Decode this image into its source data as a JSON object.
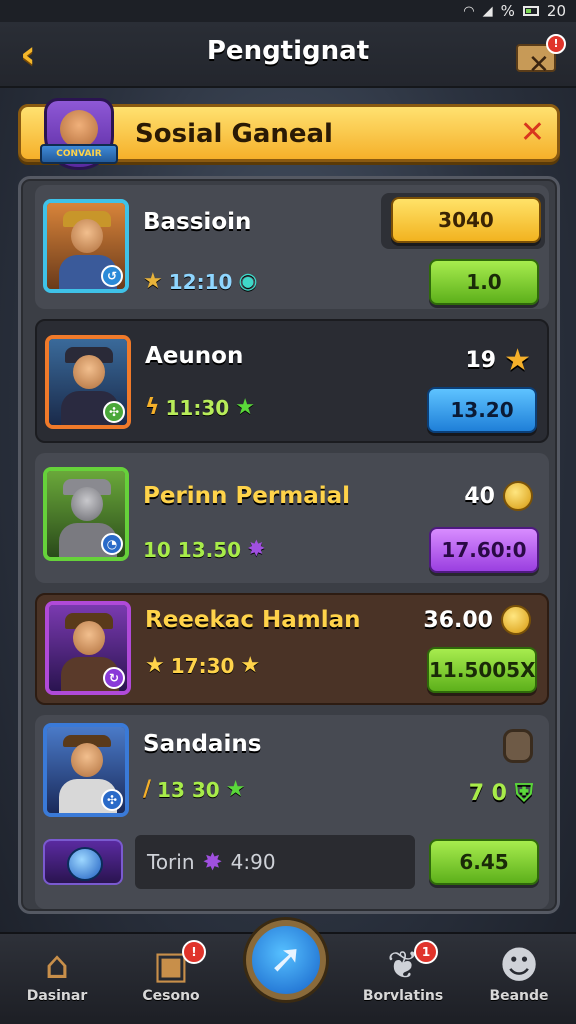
{
  "status_bar": {
    "battery_pct": "%",
    "time": "20"
  },
  "header": {
    "title": "Pengtignat",
    "back_icon": "chevron-left-icon",
    "mail_badge": "!"
  },
  "banner": {
    "title": "Sosial Ganeal",
    "crest_label": "CONVAIR",
    "close_icon": "close-icon"
  },
  "rows": [
    {
      "name": "Bassioin",
      "meta": "12:10",
      "top_value": "",
      "button": "3040",
      "button_style": "gold",
      "second_button": "1.0",
      "accent": "#3fc2e8"
    },
    {
      "name": "Aeunon",
      "meta": "11:30",
      "top_value": "19",
      "button": "13.20",
      "button_style": "blue",
      "accent": "#f07a2a"
    },
    {
      "name": "Perinn  Permaial",
      "meta": "10 13.50",
      "top_value": "40",
      "button": "17.60:0",
      "button_style": "purple",
      "accent": "#66d23a"
    },
    {
      "name": "Reeekac Hamlan",
      "meta": "17:30",
      "top_value": "36.00",
      "button": "11.5005X",
      "button_style": "green",
      "accent": "#b04ad8"
    },
    {
      "name": "Sandains",
      "meta": "13 30",
      "top_value": "7 0",
      "button": "6.45",
      "button_style": "green",
      "accent": "#3a7ad8",
      "boost_text": "Torin",
      "boost_value": "4:90"
    }
  ],
  "nav": [
    {
      "label": "Dasinar",
      "icon": "house-icon",
      "badge": ""
    },
    {
      "label": "Cesono",
      "icon": "treasure-chest-icon",
      "badge": "!"
    },
    {
      "label": "",
      "icon": "arrow-compass-icon",
      "badge": ""
    },
    {
      "label": "Borvlatins",
      "icon": "leaf-icon",
      "badge": "1"
    },
    {
      "label": "Beande",
      "icon": "profile-icon",
      "badge": ""
    }
  ],
  "colors": {
    "gold": "#f5b02a",
    "green": "#5db01b",
    "blue": "#1f7fd8",
    "purple": "#9a3fe0",
    "panel": "#3b3e45"
  }
}
